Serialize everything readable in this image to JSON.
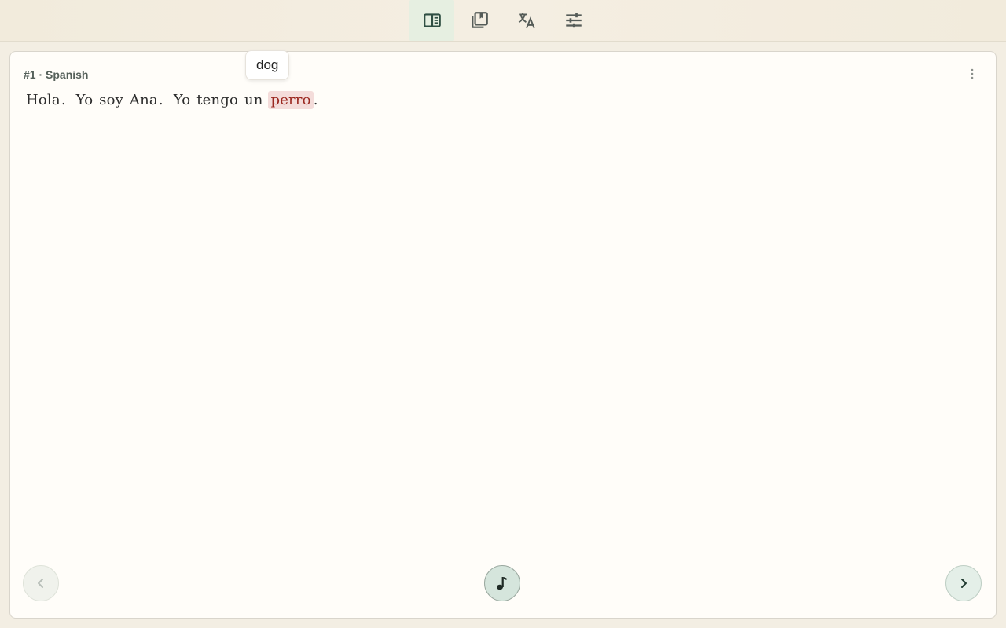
{
  "toolbar": {
    "items": [
      {
        "icon": "reader-icon",
        "active": true
      },
      {
        "icon": "bookmarks-icon",
        "active": false
      },
      {
        "icon": "translate-icon",
        "active": false
      },
      {
        "icon": "settings-sliders-icon",
        "active": false
      }
    ]
  },
  "text": {
    "title": "#1 · Spanish",
    "sentence": {
      "w1": "Hola",
      "p1": ".",
      "w2": "Yo",
      "w3": "soy",
      "w4": "Ana",
      "p2": ".",
      "w5": "Yo",
      "w6": "tengo",
      "w7": "un",
      "w8": "perro",
      "p3": "."
    },
    "highlighted_word": "perro",
    "translation_popup": "dog"
  },
  "controls": {
    "prev_icon": "chevron-left-icon",
    "audio_icon": "music-note-icon",
    "next_icon": "chevron-right-icon"
  },
  "colors": {
    "accent": "#2f4f43",
    "highlight_bg": "#f4dcda",
    "highlight_text": "#9b2820",
    "topbar_bg": "#f2ebdc",
    "card_bg": "#fffdf9"
  }
}
